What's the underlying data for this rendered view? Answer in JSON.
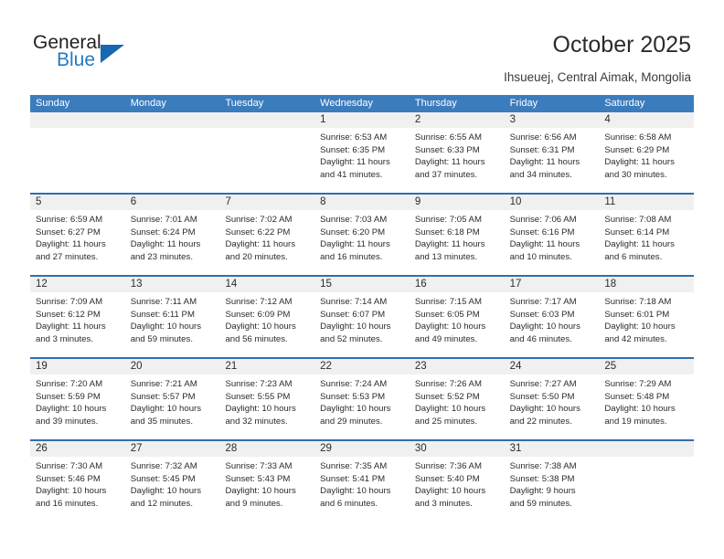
{
  "brand": {
    "name_top": "General",
    "name_bottom": "Blue",
    "triangle_icon": "triangle-icon",
    "color_top": "#231f20",
    "color_bottom": "#1f7bc4",
    "accent": "#1668b0"
  },
  "header": {
    "title": "October 2025",
    "subtitle": "Ihsueuej, Central Aimak, Mongolia"
  },
  "theme": {
    "header_bg": "#3b7cbd",
    "header_text": "#ffffff",
    "row_border": "#2f6fae",
    "day_band_bg": "#f0f0f0",
    "text": "#2b2b2b"
  },
  "weekdays": [
    "Sunday",
    "Monday",
    "Tuesday",
    "Wednesday",
    "Thursday",
    "Friday",
    "Saturday"
  ],
  "weeks": [
    [
      {
        "day": "",
        "sunrise": "",
        "sunset": "",
        "daylight_line1": "",
        "daylight_line2": "",
        "empty": true
      },
      {
        "day": "",
        "sunrise": "",
        "sunset": "",
        "daylight_line1": "",
        "daylight_line2": "",
        "empty": true
      },
      {
        "day": "",
        "sunrise": "",
        "sunset": "",
        "daylight_line1": "",
        "daylight_line2": "",
        "empty": true
      },
      {
        "day": "1",
        "sunrise": "Sunrise: 6:53 AM",
        "sunset": "Sunset: 6:35 PM",
        "daylight_line1": "Daylight: 11 hours",
        "daylight_line2": "and 41 minutes.",
        "empty": false
      },
      {
        "day": "2",
        "sunrise": "Sunrise: 6:55 AM",
        "sunset": "Sunset: 6:33 PM",
        "daylight_line1": "Daylight: 11 hours",
        "daylight_line2": "and 37 minutes.",
        "empty": false
      },
      {
        "day": "3",
        "sunrise": "Sunrise: 6:56 AM",
        "sunset": "Sunset: 6:31 PM",
        "daylight_line1": "Daylight: 11 hours",
        "daylight_line2": "and 34 minutes.",
        "empty": false
      },
      {
        "day": "4",
        "sunrise": "Sunrise: 6:58 AM",
        "sunset": "Sunset: 6:29 PM",
        "daylight_line1": "Daylight: 11 hours",
        "daylight_line2": "and 30 minutes.",
        "empty": false
      }
    ],
    [
      {
        "day": "5",
        "sunrise": "Sunrise: 6:59 AM",
        "sunset": "Sunset: 6:27 PM",
        "daylight_line1": "Daylight: 11 hours",
        "daylight_line2": "and 27 minutes.",
        "empty": false
      },
      {
        "day": "6",
        "sunrise": "Sunrise: 7:01 AM",
        "sunset": "Sunset: 6:24 PM",
        "daylight_line1": "Daylight: 11 hours",
        "daylight_line2": "and 23 minutes.",
        "empty": false
      },
      {
        "day": "7",
        "sunrise": "Sunrise: 7:02 AM",
        "sunset": "Sunset: 6:22 PM",
        "daylight_line1": "Daylight: 11 hours",
        "daylight_line2": "and 20 minutes.",
        "empty": false
      },
      {
        "day": "8",
        "sunrise": "Sunrise: 7:03 AM",
        "sunset": "Sunset: 6:20 PM",
        "daylight_line1": "Daylight: 11 hours",
        "daylight_line2": "and 16 minutes.",
        "empty": false
      },
      {
        "day": "9",
        "sunrise": "Sunrise: 7:05 AM",
        "sunset": "Sunset: 6:18 PM",
        "daylight_line1": "Daylight: 11 hours",
        "daylight_line2": "and 13 minutes.",
        "empty": false
      },
      {
        "day": "10",
        "sunrise": "Sunrise: 7:06 AM",
        "sunset": "Sunset: 6:16 PM",
        "daylight_line1": "Daylight: 11 hours",
        "daylight_line2": "and 10 minutes.",
        "empty": false
      },
      {
        "day": "11",
        "sunrise": "Sunrise: 7:08 AM",
        "sunset": "Sunset: 6:14 PM",
        "daylight_line1": "Daylight: 11 hours",
        "daylight_line2": "and 6 minutes.",
        "empty": false
      }
    ],
    [
      {
        "day": "12",
        "sunrise": "Sunrise: 7:09 AM",
        "sunset": "Sunset: 6:12 PM",
        "daylight_line1": "Daylight: 11 hours",
        "daylight_line2": "and 3 minutes.",
        "empty": false
      },
      {
        "day": "13",
        "sunrise": "Sunrise: 7:11 AM",
        "sunset": "Sunset: 6:11 PM",
        "daylight_line1": "Daylight: 10 hours",
        "daylight_line2": "and 59 minutes.",
        "empty": false
      },
      {
        "day": "14",
        "sunrise": "Sunrise: 7:12 AM",
        "sunset": "Sunset: 6:09 PM",
        "daylight_line1": "Daylight: 10 hours",
        "daylight_line2": "and 56 minutes.",
        "empty": false
      },
      {
        "day": "15",
        "sunrise": "Sunrise: 7:14 AM",
        "sunset": "Sunset: 6:07 PM",
        "daylight_line1": "Daylight: 10 hours",
        "daylight_line2": "and 52 minutes.",
        "empty": false
      },
      {
        "day": "16",
        "sunrise": "Sunrise: 7:15 AM",
        "sunset": "Sunset: 6:05 PM",
        "daylight_line1": "Daylight: 10 hours",
        "daylight_line2": "and 49 minutes.",
        "empty": false
      },
      {
        "day": "17",
        "sunrise": "Sunrise: 7:17 AM",
        "sunset": "Sunset: 6:03 PM",
        "daylight_line1": "Daylight: 10 hours",
        "daylight_line2": "and 46 minutes.",
        "empty": false
      },
      {
        "day": "18",
        "sunrise": "Sunrise: 7:18 AM",
        "sunset": "Sunset: 6:01 PM",
        "daylight_line1": "Daylight: 10 hours",
        "daylight_line2": "and 42 minutes.",
        "empty": false
      }
    ],
    [
      {
        "day": "19",
        "sunrise": "Sunrise: 7:20 AM",
        "sunset": "Sunset: 5:59 PM",
        "daylight_line1": "Daylight: 10 hours",
        "daylight_line2": "and 39 minutes.",
        "empty": false
      },
      {
        "day": "20",
        "sunrise": "Sunrise: 7:21 AM",
        "sunset": "Sunset: 5:57 PM",
        "daylight_line1": "Daylight: 10 hours",
        "daylight_line2": "and 35 minutes.",
        "empty": false
      },
      {
        "day": "21",
        "sunrise": "Sunrise: 7:23 AM",
        "sunset": "Sunset: 5:55 PM",
        "daylight_line1": "Daylight: 10 hours",
        "daylight_line2": "and 32 minutes.",
        "empty": false
      },
      {
        "day": "22",
        "sunrise": "Sunrise: 7:24 AM",
        "sunset": "Sunset: 5:53 PM",
        "daylight_line1": "Daylight: 10 hours",
        "daylight_line2": "and 29 minutes.",
        "empty": false
      },
      {
        "day": "23",
        "sunrise": "Sunrise: 7:26 AM",
        "sunset": "Sunset: 5:52 PM",
        "daylight_line1": "Daylight: 10 hours",
        "daylight_line2": "and 25 minutes.",
        "empty": false
      },
      {
        "day": "24",
        "sunrise": "Sunrise: 7:27 AM",
        "sunset": "Sunset: 5:50 PM",
        "daylight_line1": "Daylight: 10 hours",
        "daylight_line2": "and 22 minutes.",
        "empty": false
      },
      {
        "day": "25",
        "sunrise": "Sunrise: 7:29 AM",
        "sunset": "Sunset: 5:48 PM",
        "daylight_line1": "Daylight: 10 hours",
        "daylight_line2": "and 19 minutes.",
        "empty": false
      }
    ],
    [
      {
        "day": "26",
        "sunrise": "Sunrise: 7:30 AM",
        "sunset": "Sunset: 5:46 PM",
        "daylight_line1": "Daylight: 10 hours",
        "daylight_line2": "and 16 minutes.",
        "empty": false
      },
      {
        "day": "27",
        "sunrise": "Sunrise: 7:32 AM",
        "sunset": "Sunset: 5:45 PM",
        "daylight_line1": "Daylight: 10 hours",
        "daylight_line2": "and 12 minutes.",
        "empty": false
      },
      {
        "day": "28",
        "sunrise": "Sunrise: 7:33 AM",
        "sunset": "Sunset: 5:43 PM",
        "daylight_line1": "Daylight: 10 hours",
        "daylight_line2": "and 9 minutes.",
        "empty": false
      },
      {
        "day": "29",
        "sunrise": "Sunrise: 7:35 AM",
        "sunset": "Sunset: 5:41 PM",
        "daylight_line1": "Daylight: 10 hours",
        "daylight_line2": "and 6 minutes.",
        "empty": false
      },
      {
        "day": "30",
        "sunrise": "Sunrise: 7:36 AM",
        "sunset": "Sunset: 5:40 PM",
        "daylight_line1": "Daylight: 10 hours",
        "daylight_line2": "and 3 minutes.",
        "empty": false
      },
      {
        "day": "31",
        "sunrise": "Sunrise: 7:38 AM",
        "sunset": "Sunset: 5:38 PM",
        "daylight_line1": "Daylight: 9 hours",
        "daylight_line2": "and 59 minutes.",
        "empty": false
      },
      {
        "day": "",
        "sunrise": "",
        "sunset": "",
        "daylight_line1": "",
        "daylight_line2": "",
        "empty": true
      }
    ]
  ]
}
